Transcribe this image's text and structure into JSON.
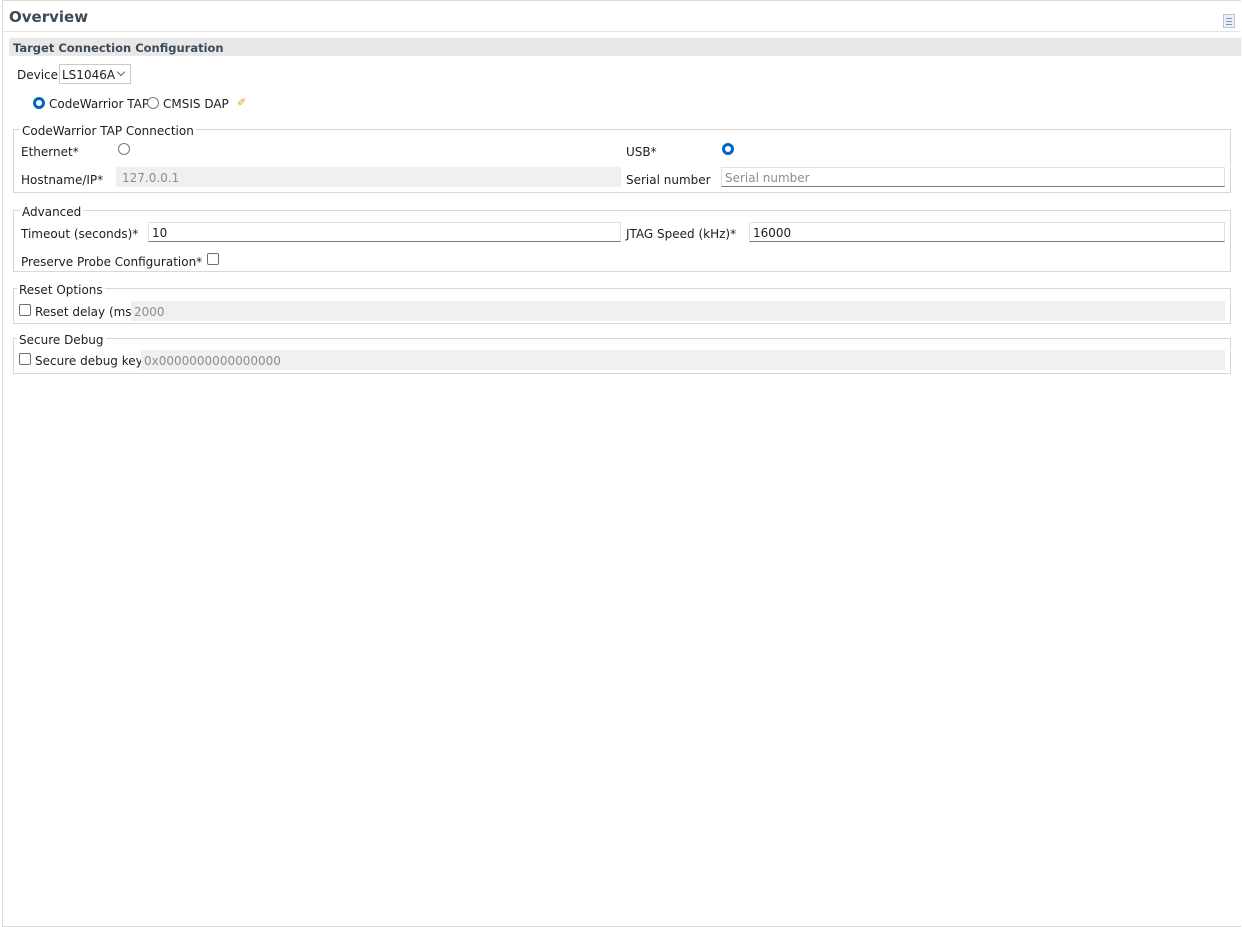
{
  "header": {
    "title": "Overview",
    "help_icon": "doc-icon"
  },
  "section": {
    "title": "Target Connection Configuration"
  },
  "device": {
    "label": "Device",
    "value": "LS1046A"
  },
  "probe": {
    "options": [
      {
        "label": "CodeWarrior TAP",
        "selected": true
      },
      {
        "label": "CMSIS DAP",
        "selected": false
      }
    ],
    "icon": "pin-icon"
  },
  "connection": {
    "legend": "CodeWarrior TAP Connection",
    "ethernet_label": "Ethernet*",
    "ethernet_selected": false,
    "usb_label": "USB*",
    "usb_selected": true,
    "hostname_label": "Hostname/IP*",
    "hostname_value": "127.0.0.1",
    "serial_label": "Serial number",
    "serial_placeholder": "Serial number"
  },
  "advanced": {
    "legend": "Advanced",
    "timeout_label": "Timeout (seconds)*",
    "timeout_value": "10",
    "jtag_label": "JTAG Speed (kHz)*",
    "jtag_value": "16000",
    "preserve_label": "Preserve Probe Configuration*",
    "preserve_checked": false
  },
  "reset": {
    "legend": "Reset Options",
    "delay_label": "Reset delay (ms):",
    "delay_value": "2000",
    "checked": false
  },
  "secure": {
    "legend": "Secure Debug",
    "key_label": "Secure debug key:",
    "key_value": "0x0000000000000000",
    "checked": false
  }
}
